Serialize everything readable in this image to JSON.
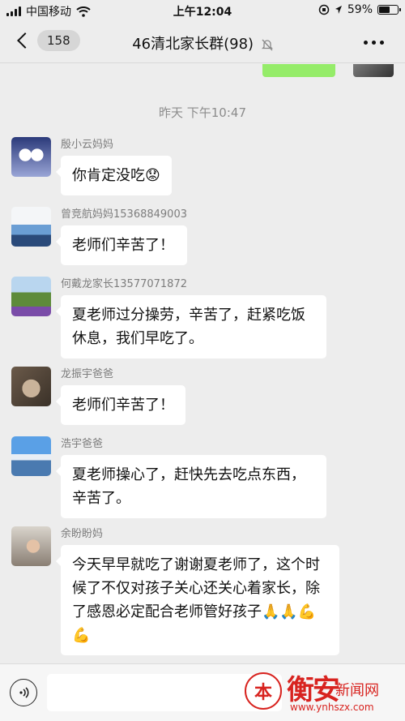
{
  "status_bar": {
    "carrier": "中国移动",
    "time": "上午12:04",
    "battery": "59%",
    "battery_level": 0.59
  },
  "nav": {
    "back_count": "158",
    "title": "46清北家长群(98)"
  },
  "timestamp": "昨天 下午10:47",
  "messages": [
    {
      "sender": "殷小云妈妈",
      "text": "你肯定没吃😟"
    },
    {
      "sender": "曾竞航妈妈15368849003",
      "text": "老师们辛苦了！"
    },
    {
      "sender": "何戴龙家长13577071872",
      "text": "夏老师过分操劳，辛苦了，赶紧吃饭休息，我们早吃了。"
    },
    {
      "sender": "龙振宇爸爸",
      "text": "老师们辛苦了！"
    },
    {
      "sender": "浩宇爸爸",
      "text": "夏老师操心了，赶快先去吃点东西，辛苦了。"
    },
    {
      "sender": "余盼盼妈",
      "text": "今天早早就吃了谢谢夏老师了，这个时候了不仅对孩子关心还关心着家长，除了感恩必定配合老师管好孩子🙏🙏💪💪"
    }
  ],
  "watermark": {
    "brand": "衡安",
    "sub": "新闻网",
    "url": "www.ynhszx.com",
    "emblem": "本"
  },
  "colors": {
    "background": "#ededed",
    "bubble": "#ffffff",
    "self_bubble": "#95ec69",
    "watermark": "#d8231f"
  }
}
